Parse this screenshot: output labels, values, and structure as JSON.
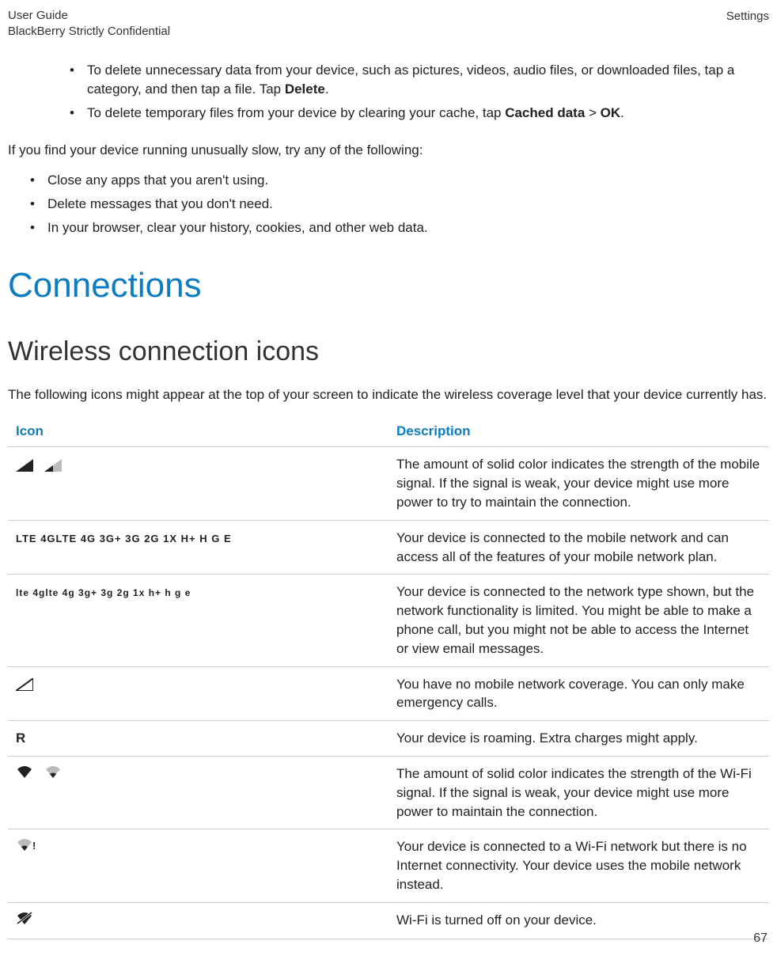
{
  "header": {
    "line1": "User Guide",
    "line2": "BlackBerry Strictly Confidential",
    "right": "Settings"
  },
  "intro_bullets": [
    {
      "pre": "To delete unnecessary data from your device, such as pictures, videos, audio files, or downloaded files, tap a category, and then tap a file. Tap ",
      "bold1": "Delete",
      "post1": "."
    },
    {
      "pre": "To delete temporary files from your device by clearing your cache, tap ",
      "bold1": "Cached data",
      "mid": " > ",
      "bold2": "OK",
      "post1": "."
    }
  ],
  "slow_para": "If you find your device running unusually slow, try any of the following:",
  "slow_bullets": [
    "Close any apps that you aren't using.",
    "Delete messages that you don't need.",
    "In your browser, clear your history, cookies, and other web data."
  ],
  "section_title": "Connections",
  "subsection_title": "Wireless connection icons",
  "subsection_para": "The following icons might appear at the top of your screen to indicate the wireless coverage level that your device currently has.",
  "table": {
    "headers": {
      "icon": "Icon",
      "desc": "Description"
    },
    "rows": [
      {
        "icon_key": "signal_pair",
        "desc": "The amount of solid color indicates the strength of the mobile signal. If the signal is weak, your device might use more power to try to maintain the connection."
      },
      {
        "icon_key": "net_full",
        "icon_text": "LTE  4GLTE  4G  3G+  3G  2G  1X  H+  H  G  E",
        "desc": "Your device is connected to the mobile network and can access all of the features of your mobile network plan."
      },
      {
        "icon_key": "net_limited",
        "icon_text": "lte  4glte  4g  3g+  3g  2g  1x  h+  h  g  e",
        "desc": "Your device is connected to the network type shown, but the network functionality is limited. You might be able to make a phone call, but you might not be able to access the Internet or view email messages."
      },
      {
        "icon_key": "no_coverage",
        "desc": "You have no mobile network coverage. You can only make emergency calls."
      },
      {
        "icon_key": "roaming",
        "icon_text": "R",
        "desc": "Your device is roaming. Extra charges might apply."
      },
      {
        "icon_key": "wifi_pair",
        "desc": "The amount of solid color indicates the strength of the Wi-Fi signal. If the signal is weak, your device might use more power to maintain the connection."
      },
      {
        "icon_key": "wifi_bang",
        "desc": "Your device is connected to a Wi-Fi network but there is no Internet connectivity. Your device uses the mobile network instead."
      },
      {
        "icon_key": "wifi_off",
        "desc": "Wi-Fi is turned off on your device."
      }
    ]
  },
  "page_number": "67"
}
